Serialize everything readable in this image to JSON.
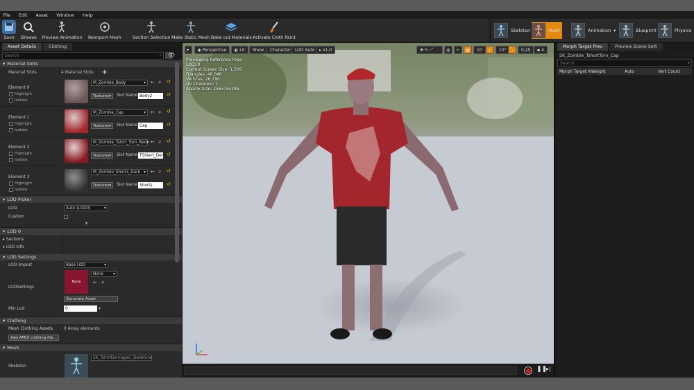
{
  "menu": [
    "File",
    "Edit",
    "Asset",
    "Window",
    "Help"
  ],
  "toolbar": {
    "save": "Save",
    "browse": "Browse",
    "preview_animation": "Preview Animation",
    "reimport_mesh": "Reimport Mesh",
    "section_selection": "Section Selection",
    "make_static_mesh": "Make Static Mesh",
    "bake_out_materials": "Bake out Materials",
    "activate_cloth_paint": "Activate Cloth Paint"
  },
  "modes": {
    "skeleton": "Skeleton",
    "mesh": "Mesh",
    "animation": "Animation",
    "blueprint": "Blueprint",
    "physics": "Physics"
  },
  "left": {
    "tabs": [
      "Asset Details",
      "Clothing"
    ],
    "search_placeholder": "Search",
    "material_slots": {
      "header": "Material Slots",
      "label": "Material Slots",
      "count": "4 Material Slots",
      "elements": [
        {
          "name": "Element 0",
          "material": "M_Zombie_Body",
          "slot": "Body2"
        },
        {
          "name": "Element 1",
          "material": "M_Zombie_Cap",
          "slot": "Cap"
        },
        {
          "name": "Element 2",
          "material": "M_Zombie_Tshirt_Torn_Red",
          "slot": "TShiert_Den"
        },
        {
          "name": "Element 3",
          "material": "M_Zombie_Shorts_Dark",
          "slot": "Shorts"
        }
      ],
      "highlight": "Highlight",
      "isolate": "Isolate",
      "textures": "Textures",
      "slot_name": "Slot Name"
    },
    "lod_picker": {
      "header": "LOD Picker",
      "lod_label": "LOD",
      "lod_value": "Auto (LOD0)",
      "custom": "Custom"
    },
    "lod0": {
      "header": "LOD 0",
      "sections": "Sections",
      "lod_info": "LOD Info"
    },
    "lod_settings": {
      "header": "LOD Settings",
      "lod_import": "LOD Import",
      "lod_import_value": "Base LOD",
      "lodsettings": "LODSettings",
      "thumb_text": "None",
      "none_value": "None",
      "generate": "Generate Asset",
      "min_lod": "Min Lod",
      "min_lod_value": "0"
    },
    "clothing": {
      "header": "Clothing",
      "assets": "Mesh Clothing Assets",
      "count": "0 Array elements",
      "add": "Add APEX clothing file..."
    },
    "mesh": {
      "header": "Mesh",
      "skeleton": "Skeleton",
      "skeleton_value": "SK_TshirtDemaged_Skeleton"
    }
  },
  "viewport": {
    "perspective": "Perspective",
    "lit": "Lit",
    "show": "Show",
    "character": "Character",
    "lod": "LOD Auto",
    "speed": "x1,0",
    "info": [
      "Previewing Reference Pose",
      "LOD: 0",
      "Current Screen Size: 1,509",
      "Triangles: 46,046",
      "Vertices: 26,790",
      "UV Channels: 1",
      "Approx Size: 256x76x285"
    ],
    "grid": "10",
    "angle": "10°",
    "scale": "0,25",
    "cam": "4"
  },
  "right": {
    "tabs": [
      "Morph Target Prev",
      "Preview Scene Sett"
    ],
    "asset": "SK_Zombie_TshortTorn_Cap",
    "search_placeholder": "Search",
    "cols": [
      "Morph Target N",
      "Weight",
      "Auto",
      "Vert Count"
    ]
  },
  "colors": {
    "accent": "#e6870e",
    "bg": "#1a1a1a",
    "header": "#3b3b3b"
  }
}
